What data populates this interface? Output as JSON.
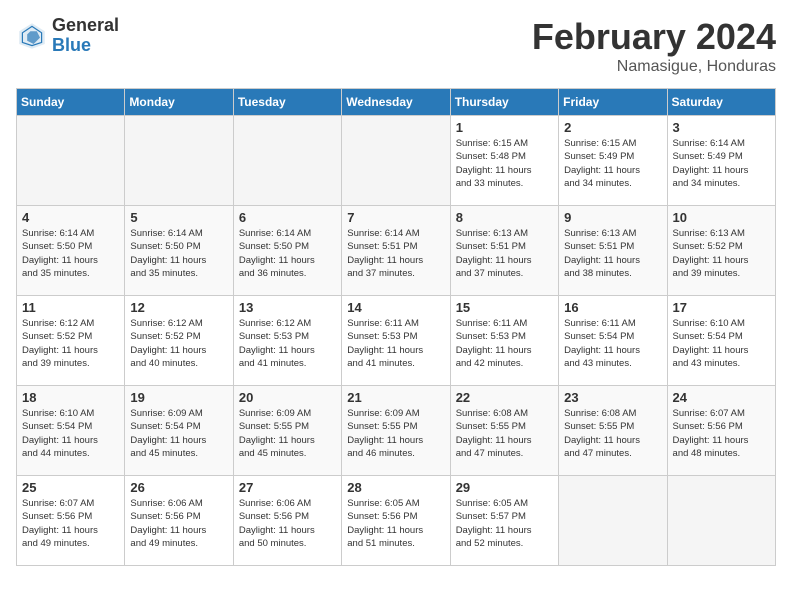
{
  "header": {
    "logo_general": "General",
    "logo_blue": "Blue",
    "month_title": "February 2024",
    "location": "Namasigue, Honduras"
  },
  "weekdays": [
    "Sunday",
    "Monday",
    "Tuesday",
    "Wednesday",
    "Thursday",
    "Friday",
    "Saturday"
  ],
  "weeks": [
    [
      {
        "day": "",
        "info": "",
        "empty": true
      },
      {
        "day": "",
        "info": "",
        "empty": true
      },
      {
        "day": "",
        "info": "",
        "empty": true
      },
      {
        "day": "",
        "info": "",
        "empty": true
      },
      {
        "day": "1",
        "info": "Sunrise: 6:15 AM\nSunset: 5:48 PM\nDaylight: 11 hours\nand 33 minutes.",
        "empty": false
      },
      {
        "day": "2",
        "info": "Sunrise: 6:15 AM\nSunset: 5:49 PM\nDaylight: 11 hours\nand 34 minutes.",
        "empty": false
      },
      {
        "day": "3",
        "info": "Sunrise: 6:14 AM\nSunset: 5:49 PM\nDaylight: 11 hours\nand 34 minutes.",
        "empty": false
      }
    ],
    [
      {
        "day": "4",
        "info": "Sunrise: 6:14 AM\nSunset: 5:50 PM\nDaylight: 11 hours\nand 35 minutes.",
        "empty": false
      },
      {
        "day": "5",
        "info": "Sunrise: 6:14 AM\nSunset: 5:50 PM\nDaylight: 11 hours\nand 35 minutes.",
        "empty": false
      },
      {
        "day": "6",
        "info": "Sunrise: 6:14 AM\nSunset: 5:50 PM\nDaylight: 11 hours\nand 36 minutes.",
        "empty": false
      },
      {
        "day": "7",
        "info": "Sunrise: 6:14 AM\nSunset: 5:51 PM\nDaylight: 11 hours\nand 37 minutes.",
        "empty": false
      },
      {
        "day": "8",
        "info": "Sunrise: 6:13 AM\nSunset: 5:51 PM\nDaylight: 11 hours\nand 37 minutes.",
        "empty": false
      },
      {
        "day": "9",
        "info": "Sunrise: 6:13 AM\nSunset: 5:51 PM\nDaylight: 11 hours\nand 38 minutes.",
        "empty": false
      },
      {
        "day": "10",
        "info": "Sunrise: 6:13 AM\nSunset: 5:52 PM\nDaylight: 11 hours\nand 39 minutes.",
        "empty": false
      }
    ],
    [
      {
        "day": "11",
        "info": "Sunrise: 6:12 AM\nSunset: 5:52 PM\nDaylight: 11 hours\nand 39 minutes.",
        "empty": false
      },
      {
        "day": "12",
        "info": "Sunrise: 6:12 AM\nSunset: 5:52 PM\nDaylight: 11 hours\nand 40 minutes.",
        "empty": false
      },
      {
        "day": "13",
        "info": "Sunrise: 6:12 AM\nSunset: 5:53 PM\nDaylight: 11 hours\nand 41 minutes.",
        "empty": false
      },
      {
        "day": "14",
        "info": "Sunrise: 6:11 AM\nSunset: 5:53 PM\nDaylight: 11 hours\nand 41 minutes.",
        "empty": false
      },
      {
        "day": "15",
        "info": "Sunrise: 6:11 AM\nSunset: 5:53 PM\nDaylight: 11 hours\nand 42 minutes.",
        "empty": false
      },
      {
        "day": "16",
        "info": "Sunrise: 6:11 AM\nSunset: 5:54 PM\nDaylight: 11 hours\nand 43 minutes.",
        "empty": false
      },
      {
        "day": "17",
        "info": "Sunrise: 6:10 AM\nSunset: 5:54 PM\nDaylight: 11 hours\nand 43 minutes.",
        "empty": false
      }
    ],
    [
      {
        "day": "18",
        "info": "Sunrise: 6:10 AM\nSunset: 5:54 PM\nDaylight: 11 hours\nand 44 minutes.",
        "empty": false
      },
      {
        "day": "19",
        "info": "Sunrise: 6:09 AM\nSunset: 5:54 PM\nDaylight: 11 hours\nand 45 minutes.",
        "empty": false
      },
      {
        "day": "20",
        "info": "Sunrise: 6:09 AM\nSunset: 5:55 PM\nDaylight: 11 hours\nand 45 minutes.",
        "empty": false
      },
      {
        "day": "21",
        "info": "Sunrise: 6:09 AM\nSunset: 5:55 PM\nDaylight: 11 hours\nand 46 minutes.",
        "empty": false
      },
      {
        "day": "22",
        "info": "Sunrise: 6:08 AM\nSunset: 5:55 PM\nDaylight: 11 hours\nand 47 minutes.",
        "empty": false
      },
      {
        "day": "23",
        "info": "Sunrise: 6:08 AM\nSunset: 5:55 PM\nDaylight: 11 hours\nand 47 minutes.",
        "empty": false
      },
      {
        "day": "24",
        "info": "Sunrise: 6:07 AM\nSunset: 5:56 PM\nDaylight: 11 hours\nand 48 minutes.",
        "empty": false
      }
    ],
    [
      {
        "day": "25",
        "info": "Sunrise: 6:07 AM\nSunset: 5:56 PM\nDaylight: 11 hours\nand 49 minutes.",
        "empty": false
      },
      {
        "day": "26",
        "info": "Sunrise: 6:06 AM\nSunset: 5:56 PM\nDaylight: 11 hours\nand 49 minutes.",
        "empty": false
      },
      {
        "day": "27",
        "info": "Sunrise: 6:06 AM\nSunset: 5:56 PM\nDaylight: 11 hours\nand 50 minutes.",
        "empty": false
      },
      {
        "day": "28",
        "info": "Sunrise: 6:05 AM\nSunset: 5:56 PM\nDaylight: 11 hours\nand 51 minutes.",
        "empty": false
      },
      {
        "day": "29",
        "info": "Sunrise: 6:05 AM\nSunset: 5:57 PM\nDaylight: 11 hours\nand 52 minutes.",
        "empty": false
      },
      {
        "day": "",
        "info": "",
        "empty": true
      },
      {
        "day": "",
        "info": "",
        "empty": true
      }
    ]
  ]
}
